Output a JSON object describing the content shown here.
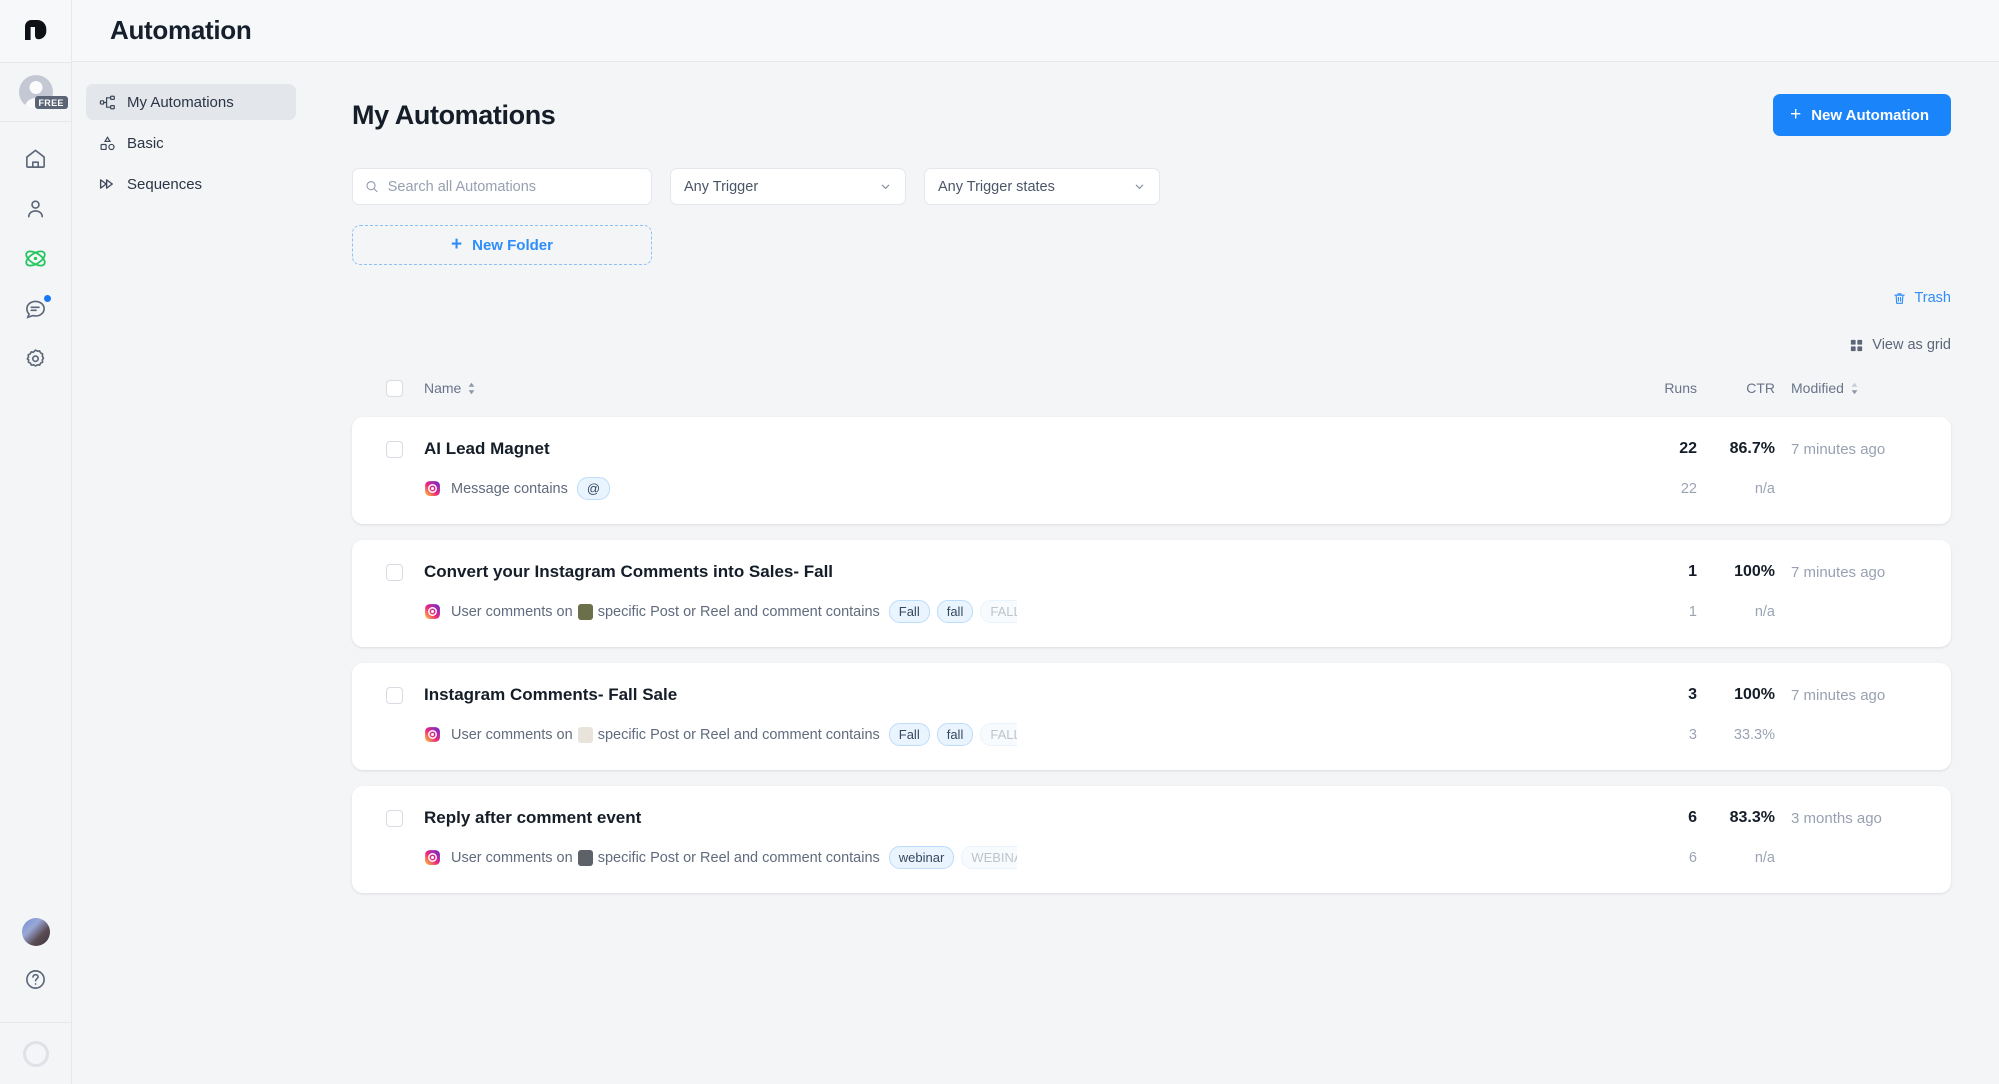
{
  "app": {
    "logo_text": "M",
    "plan_badge": "FREE",
    "header_title": "Automation"
  },
  "rail": {
    "items": [
      {
        "name": "home-icon",
        "label": "Home"
      },
      {
        "name": "contacts-icon",
        "label": "Contacts"
      },
      {
        "name": "automation-icon",
        "label": "Automation",
        "active": true,
        "color": "#22c55e"
      },
      {
        "name": "inbox-icon",
        "label": "Inbox",
        "has_badge": true,
        "badge_color": "#1877f2"
      },
      {
        "name": "settings-icon",
        "label": "Settings"
      }
    ],
    "bottom": [
      {
        "name": "user-avatar",
        "label": "Account"
      },
      {
        "name": "help-icon",
        "label": "Help"
      },
      {
        "name": "progress-ring",
        "label": "Onboarding progress"
      }
    ]
  },
  "sidebar": {
    "items": [
      {
        "label": "My Automations",
        "icon": "flow-icon",
        "active": true
      },
      {
        "label": "Basic",
        "icon": "shapes-icon",
        "active": false
      },
      {
        "label": "Sequences",
        "icon": "double-chevron-icon",
        "active": false
      }
    ]
  },
  "page": {
    "title": "My Automations",
    "new_automation_label": "New Automation",
    "new_folder_label": "New Folder",
    "trash_label": "Trash",
    "view_as_grid_label": "View as grid",
    "accent_color": "#1a84fb",
    "link_color": "#2f8df9"
  },
  "filters": {
    "search_placeholder": "Search all Automations",
    "search_value": "",
    "trigger_select": "Any Trigger",
    "trigger_states_select": "Any Trigger states"
  },
  "table": {
    "headers": {
      "name": "Name",
      "runs": "Runs",
      "ctr": "CTR",
      "modified": "Modified"
    },
    "rows": [
      {
        "name": "AI Lead Magnet",
        "runs": "22",
        "ctr": "86.7%",
        "modified": "7 minutes ago",
        "trigger_platform": "instagram",
        "trigger_text_before": "Message contains",
        "trigger_text_after": "",
        "has_thumb": false,
        "thumb_color": "",
        "chips": [
          {
            "label": "@",
            "faded": false
          }
        ],
        "sub_runs": "22",
        "sub_ctr": "n/a"
      },
      {
        "name": "Convert your Instagram Comments into Sales- Fall",
        "runs": "1",
        "ctr": "100%",
        "modified": "7 minutes ago",
        "trigger_platform": "instagram",
        "trigger_text_before": "User comments on",
        "trigger_text_after": "specific Post or Reel and comment contains",
        "has_thumb": true,
        "thumb_color": "#6b6f4a",
        "chips": [
          {
            "label": "Fall",
            "faded": false
          },
          {
            "label": "fall",
            "faded": false
          },
          {
            "label": "FALL",
            "faded": true
          }
        ],
        "sub_runs": "1",
        "sub_ctr": "n/a"
      },
      {
        "name": "Instagram Comments- Fall Sale",
        "runs": "3",
        "ctr": "100%",
        "modified": "7 minutes ago",
        "trigger_platform": "instagram",
        "trigger_text_before": "User comments on",
        "trigger_text_after": "specific Post or Reel and comment contains",
        "has_thumb": true,
        "thumb_color": "#e8e4db",
        "chips": [
          {
            "label": "Fall",
            "faded": false
          },
          {
            "label": "fall",
            "faded": false
          },
          {
            "label": "FALL",
            "faded": true
          }
        ],
        "sub_runs": "3",
        "sub_ctr": "33.3%"
      },
      {
        "name": "Reply after comment event",
        "runs": "6",
        "ctr": "83.3%",
        "modified": "3 months ago",
        "trigger_platform": "instagram",
        "trigger_text_before": "User comments on",
        "trigger_text_after": "specific Post or Reel and comment contains",
        "has_thumb": true,
        "thumb_color": "#5d6168",
        "chips": [
          {
            "label": "webinar",
            "faded": false
          },
          {
            "label": "WEBINAR",
            "faded": true
          }
        ],
        "sub_runs": "6",
        "sub_ctr": "n/a"
      }
    ]
  }
}
